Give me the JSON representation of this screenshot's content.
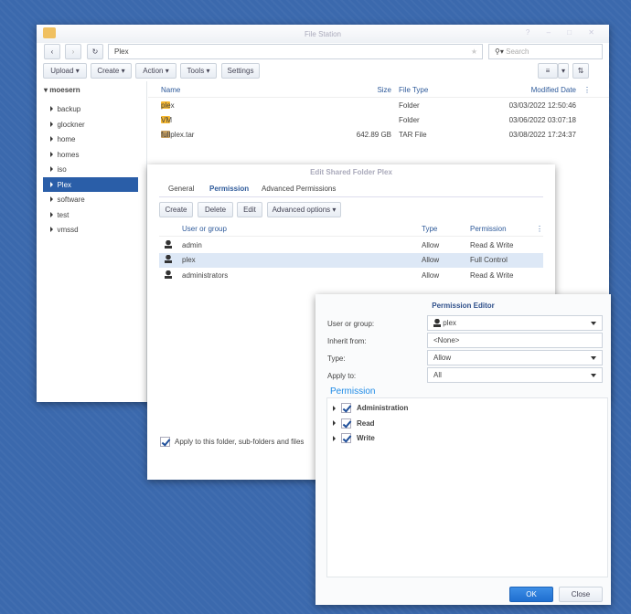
{
  "file_station": {
    "title": "File Station",
    "path": "Plex",
    "search_placeholder": "Search",
    "toolbar": [
      "Upload",
      "Create",
      "Action",
      "Tools",
      "Settings"
    ],
    "tree_root": "moesern",
    "tree": [
      "backup",
      "glockner",
      "home",
      "homes",
      "iso",
      "Plex",
      "software",
      "test",
      "vmssd"
    ],
    "selected_tree": "Plex",
    "columns": {
      "name": "Name",
      "size": "Size",
      "type": "File Type",
      "date": "Modified Date"
    },
    "files": [
      {
        "name": "plex",
        "size": "",
        "type": "Folder",
        "date": "03/03/2022 12:50:46",
        "icon": "folder"
      },
      {
        "name": "VM",
        "size": "",
        "type": "Folder",
        "date": "03/06/2022 03:07:18",
        "icon": "folder"
      },
      {
        "name": "fullplex.tar",
        "size": "642.89 GB",
        "type": "TAR File",
        "date": "03/08/2022 17:24:37",
        "icon": "archive"
      }
    ]
  },
  "edit_dialog": {
    "title": "Edit Shared Folder Plex",
    "tabs": [
      "General",
      "Permission",
      "Advanced Permissions"
    ],
    "active_tab": "Permission",
    "buttons": [
      "Create",
      "Delete",
      "Edit",
      "Advanced options"
    ],
    "columns": {
      "user": "User or group",
      "type": "Type",
      "perm": "Permission"
    },
    "rows": [
      {
        "user": "admin",
        "type": "Allow",
        "perm": "Read & Write"
      },
      {
        "user": "plex",
        "type": "Allow",
        "perm": "Full Control"
      },
      {
        "user": "administrators",
        "type": "Allow",
        "perm": "Read & Write"
      }
    ],
    "apply_label": "Apply to this folder, sub-folders and files"
  },
  "perm_editor": {
    "title": "Permission Editor",
    "fields": [
      {
        "label": "User or group:",
        "value": "plex"
      },
      {
        "label": "Inherit from:",
        "value": "<None>"
      },
      {
        "label": "Type:",
        "value": "Allow"
      },
      {
        "label": "Apply to:",
        "value": "All"
      }
    ],
    "section": "Permission",
    "perms": [
      "Administration",
      "Read",
      "Write"
    ],
    "ok": "OK",
    "close": "Close"
  }
}
